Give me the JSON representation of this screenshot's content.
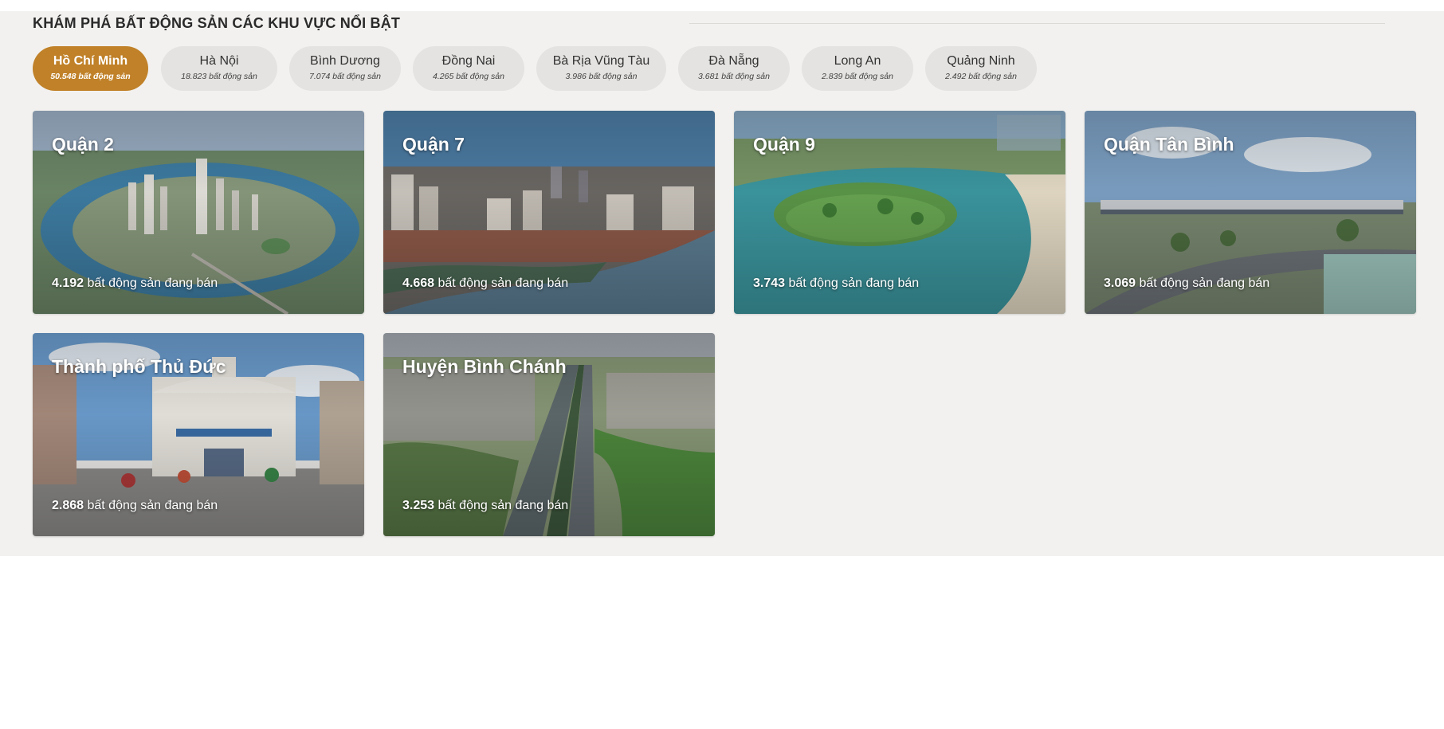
{
  "section": {
    "title": "KHÁM PHÁ BẤT ĐỘNG SẢN CÁC KHU VỰC NỔI BẬT"
  },
  "tabs": [
    {
      "name": "Hồ Chí Minh",
      "count": "50.548 bất động sản",
      "active": true
    },
    {
      "name": "Hà Nội",
      "count": "18.823 bất động sản",
      "active": false
    },
    {
      "name": "Bình Dương",
      "count": "7.074 bất động sản",
      "active": false
    },
    {
      "name": "Đồng Nai",
      "count": "4.265 bất động sản",
      "active": false
    },
    {
      "name": "Bà Rịa Vũng Tàu",
      "count": "3.986 bất động sản",
      "active": false
    },
    {
      "name": "Đà Nẵng",
      "count": "3.681 bất động sản",
      "active": false
    },
    {
      "name": "Long An",
      "count": "2.839 bất động sản",
      "active": false
    },
    {
      "name": "Quảng Ninh",
      "count": "2.492 bất động sản",
      "active": false
    }
  ],
  "cards": [
    {
      "name": "Quận 2",
      "number": "4.192",
      "suffix": " bất động sản đang bán"
    },
    {
      "name": "Quận 7",
      "number": "4.668",
      "suffix": " bất động sản đang bán"
    },
    {
      "name": "Quận 9",
      "number": "3.743",
      "suffix": " bất động sản đang bán"
    },
    {
      "name": "Quận Tân Bình",
      "number": "3.069",
      "suffix": " bất động sản đang bán"
    },
    {
      "name": "Thành phố Thủ Đức",
      "number": "2.868",
      "suffix": " bất động sản đang bán"
    },
    {
      "name": "Huyện Bình Chánh",
      "number": "3.253",
      "suffix": " bất động sản đang bán"
    }
  ],
  "colors": {
    "accent": "#c08128",
    "tab_bg": "#e4e3e1",
    "section_bg": "#f2f1ef"
  }
}
